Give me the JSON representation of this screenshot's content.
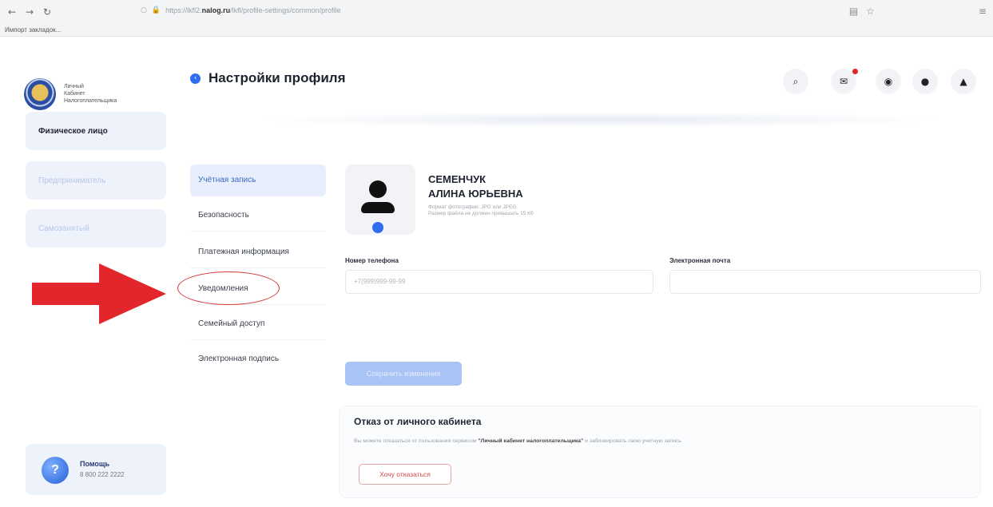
{
  "browser": {
    "url_prefix": "https://lkfl2.",
    "url_domain": "nalog.ru",
    "url_path": "/lkfl/profile-settings/common/profile",
    "bookmark": "Импорт закладок...",
    "icons": [
      "back-icon",
      "forward-icon",
      "reload-icon",
      "shield-icon",
      "lock-icon",
      "reader-icon",
      "star-icon",
      "menu-icon"
    ]
  },
  "brand": {
    "logo_line1": "Личный",
    "logo_line2": "Кабинет",
    "logo_line3": "Налогоплательщика"
  },
  "roles": [
    {
      "label": "Физическое лицо",
      "active": true
    },
    {
      "label": "Предприниматель",
      "active": false
    },
    {
      "label": "Самозанятый",
      "active": false
    }
  ],
  "header": {
    "title": "Настройки профиля",
    "icons": [
      "search-icon",
      "mail-icon",
      "eye-icon",
      "bulb-icon",
      "user-icon"
    ]
  },
  "menu": {
    "items": [
      {
        "label": "Учётная запись",
        "active": true
      },
      {
        "label": "Безопасность",
        "active": false
      },
      {
        "label": "Платежная информация",
        "active": false
      },
      {
        "label": "Уведомления",
        "active": false
      },
      {
        "label": "Семейный доступ",
        "active": false
      },
      {
        "label": "Электронная подпись",
        "active": false
      }
    ]
  },
  "profile": {
    "surname": "СЕМЕНЧУК",
    "given": "АЛИНА ЮРЬЕВНА",
    "hint1": "Формат фотографии: JPG или JPEG",
    "hint2": "Размер файла не должен превышать 15 Кб",
    "phone_label": "Номер телефона",
    "phone_value": "+7(999)999-99-99",
    "email_label": "Электронная почта",
    "email_value": "",
    "save_label": "Сохранить изменения"
  },
  "refusal": {
    "title": "Отказ от личного кабинета",
    "text_before": "Вы можете отказаться от пользования сервисом",
    "text_bold": "\"Личный кабинет налогоплательщика\"",
    "text_after": "и заблокировать свою учетную запись",
    "button": "Хочу отказаться"
  },
  "help": {
    "title": "Помощь",
    "phone": "8 800 222 2222"
  },
  "colors": {
    "accent": "#2f6cf0",
    "danger": "#d34848",
    "annotation": "#e3262c"
  }
}
